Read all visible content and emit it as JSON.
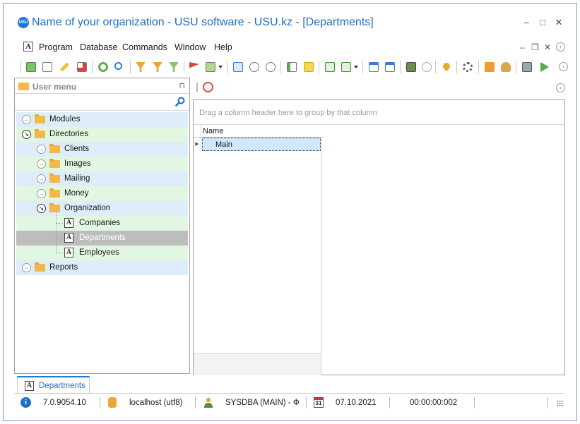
{
  "window": {
    "title": "Name of your organization - USU software - USU.kz - [Departments]",
    "logo_text": "USU",
    "controls": {
      "minimize": "–",
      "maximize": "□",
      "close": "✕"
    }
  },
  "menu": {
    "items": [
      "Program",
      "Database",
      "Commands",
      "Window",
      "Help"
    ],
    "mdi_controls": {
      "minimize": "–",
      "restore": "❐",
      "close": "✕"
    }
  },
  "user_menu": {
    "title": "User menu",
    "pin": "⊓"
  },
  "tree": [
    {
      "label": "Modules",
      "level": 0,
      "type": "folder",
      "state": "collapsed",
      "bg": "blue"
    },
    {
      "label": "Directories",
      "level": 0,
      "type": "folder",
      "state": "expanded",
      "bg": "green"
    },
    {
      "label": "Clients",
      "level": 1,
      "type": "folder",
      "state": "collapsed",
      "bg": "blue"
    },
    {
      "label": "Images",
      "level": 1,
      "type": "folder",
      "state": "collapsed",
      "bg": "green"
    },
    {
      "label": "Mailing",
      "level": 1,
      "type": "folder",
      "state": "collapsed",
      "bg": "blue"
    },
    {
      "label": "Money",
      "level": 1,
      "type": "folder",
      "state": "collapsed",
      "bg": "green"
    },
    {
      "label": "Organization",
      "level": 1,
      "type": "folder",
      "state": "expanded",
      "bg": "blue"
    },
    {
      "label": "Companies",
      "level": 2,
      "type": "doc",
      "bg": "green"
    },
    {
      "label": "Departments",
      "level": 2,
      "type": "doc",
      "bg": "selected"
    },
    {
      "label": "Employees",
      "level": 2,
      "type": "doc",
      "bg": "green"
    },
    {
      "label": "Reports",
      "level": 0,
      "type": "folder",
      "state": "collapsed",
      "bg": "blue"
    }
  ],
  "grid": {
    "group_hint": "Drag a column header here to group by that column",
    "columns": [
      "Name"
    ],
    "rows": [
      [
        "Main"
      ]
    ],
    "row_indicator": "▶"
  },
  "doc_tab": {
    "label": "Departments"
  },
  "status": {
    "version": "7.0.9054.10",
    "server": "localhost (utf8)",
    "user": "SYSDBA (MAIN) - Ф",
    "calendar_day": "31",
    "date": "07.10.2021",
    "elapsed": "00:00:00:002"
  },
  "toolbar_icons": [
    "add-icon",
    "copy-icon",
    "edit-icon",
    "delete-icon",
    "refresh-icon",
    "search-icon",
    "filter-icon",
    "filter-clear-icon",
    "filter-settings-icon",
    "flag-icon",
    "image-icon",
    "column-chooser-icon",
    "collapse-all-icon",
    "expand-all-icon",
    "add-row-icon",
    "note-icon",
    "export-icon",
    "import-icon",
    "window-close-icon",
    "window-new-icon",
    "exit-icon",
    "location-pin-icon",
    "settings-icon",
    "rss-icon",
    "users-icon",
    "print-icon",
    "play-icon"
  ]
}
